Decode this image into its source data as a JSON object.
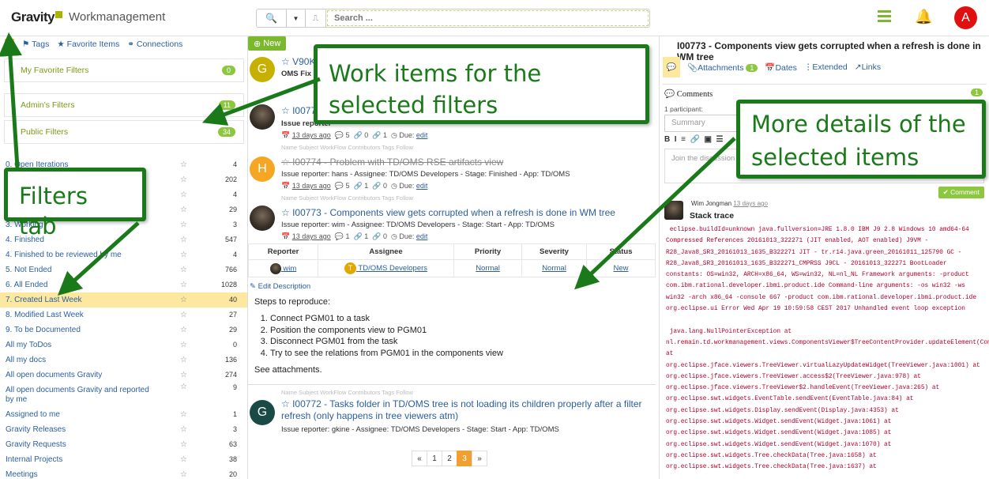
{
  "header": {
    "logo": "Gravity",
    "app_title": "Workmanagement",
    "search_placeholder": "Search ...",
    "avatar_letter": "A"
  },
  "left": {
    "tabs": [
      "Tags",
      "Favorite Items",
      "Connections"
    ],
    "fav_filters": {
      "label": "My Favorite Filters",
      "count": "0"
    },
    "admin_filters": {
      "label": "Admin's Filters",
      "count": "11"
    },
    "public_filters": {
      "label": "Public Filters",
      "count": "34"
    },
    "filters": [
      {
        "label": "0. Open Iterations",
        "count": "4"
      },
      {
        "label": "",
        "count": "202"
      },
      {
        "label": "",
        "count": "4"
      },
      {
        "label": "",
        "count": "29"
      },
      {
        "label": "3. Working",
        "count": "3"
      },
      {
        "label": "4. Finished",
        "count": "547"
      },
      {
        "label": "4. Finished to be reviewed by me",
        "count": "4"
      },
      {
        "label": "5. Not Ended",
        "count": "766"
      },
      {
        "label": "6. All Ended",
        "count": "1028"
      },
      {
        "label": "7. Created Last Week",
        "count": "40"
      },
      {
        "label": "8. Modified Last Week",
        "count": "27"
      },
      {
        "label": "9. To be Documented",
        "count": "29"
      },
      {
        "label": "All my ToDos",
        "count": "0"
      },
      {
        "label": "All my docs",
        "count": "136"
      },
      {
        "label": "All open documents Gravity",
        "count": "274"
      },
      {
        "label": "All open documents Gravity and reported by me",
        "count": "9"
      },
      {
        "label": "Assigned to me",
        "count": "1"
      },
      {
        "label": "Gravity Releases",
        "count": "3"
      },
      {
        "label": "Gravity Requests",
        "count": "63"
      },
      {
        "label": "Internal Projects",
        "count": "38"
      },
      {
        "label": "Meetings",
        "count": "20"
      }
    ]
  },
  "middle": {
    "new_label": "New",
    "items": [
      {
        "avatar": "G",
        "title": "V90K",
        "meta": "OMS Fix re"
      },
      {
        "avatar": "",
        "title": "I0077",
        "meta": "Issue reporter",
        "age": "13 days ago",
        "comments": "5",
        "links": "0",
        "subs": "1",
        "due": "Due:",
        "due_link": "edit"
      },
      {
        "avatar": "H",
        "title": "I00774 - Problem with TD/OMS RSE artifacts view",
        "meta": "Issue reporter: hans - Assignee: TD/OMS Developers - Stage: Finished - App: TD/OMS",
        "age": "13 days ago",
        "comments": "5",
        "links": "1",
        "subs": "0",
        "due": "Due:",
        "due_link": "edit"
      },
      {
        "avatar": "",
        "title": "I00773 - Components view gets corrupted when a refresh is done in WM tree",
        "meta": "Issue reporter: wim - Assignee: TD/OMS Developers - Stage: Start - App: TD/OMS",
        "age": "13 days ago",
        "comments": "1",
        "links": "1",
        "subs": "0",
        "due": "Due:",
        "due_link": "edit"
      },
      {
        "avatar": "G",
        "title": "I00772 - Tasks folder in TD/OMS tree is not loading its children properly after a filter refresh (only happens in tree viewers atm)",
        "meta": "Issue reporter: gkine - Assignee: TD/OMS Developers - Stage: Start - App: TD/OMS"
      }
    ],
    "toolbar_words": "Name  Subject  WorkFlow  Contributors  Tags  Follow",
    "table_headers": [
      "Reporter",
      "Assignee",
      "Priority",
      "Severity",
      "Status"
    ],
    "table_row": {
      "reporter": "wim",
      "assignee_badge": "T",
      "assignee": "TD/OMS Developers",
      "priority": "Normal",
      "severity": "Normal",
      "status": "New"
    },
    "edit_description": "Edit Description",
    "steps_title": "Steps to reproduce:",
    "steps": [
      "Connect PGM01 to a task",
      "Position the components view to PGM01",
      "Disconnect PGM01 from the task",
      "Try to see the relations from PGM01 in the components view"
    ],
    "see_attachments": "See attachments.",
    "pager": [
      "«",
      "1",
      "2",
      "3",
      "»"
    ]
  },
  "right": {
    "title": "I00773 - Components view gets corrupted when a refresh is done in WM tree",
    "tabs": {
      "attachments": "Attachments",
      "attachments_count": "1",
      "dates": "Dates",
      "extended": "Extended",
      "links": "Links"
    },
    "comments_label": "Comments",
    "comments_count": "1",
    "participants": "1 participant:",
    "summary_placeholder": "Summary",
    "textarea_placeholder": "Join the discussion",
    "comment_button": "Comment",
    "author": "Wim Jongman",
    "author_date": "13 days ago",
    "stack_title": "Stack trace",
    "stack_text": " eclipse.buildId=unknown java.fullversion=JRE 1.8.0 IBM J9 2.8 Windows 10 amd64-64 Compressed References 20161013_322271 (JIT enabled, AOT enabled) J9VM - R28_Java8_SR3_20161013_1635_B322271 JIT - tr.r14.java.green_20161011_125790 GC - R28_Java8_SR3_20161013_1635_B322271_CMPRSS J9CL - 20161013_322271 BootLoader constants: OS=win32, ARCH=x86_64, WS=win32, NL=nl_NL Framework arguments: -product com.ibm.rational.developer.ibmi.product.ide Command-line arguments: -os win32 -ws win32 -arch x86_64 -console 667 -product com.ibm.rational.developer.ibmi.product.ide org.eclipse.ui Error Wed Apr 19 10:59:58 CEST 2017 Unhandled event loop exception\n\n java.lang.NullPointerException at\nnl.remain.td.workmanagement.views.ComponentsViewer$TreeContentProvider.updateElement(ComponentsViewer.java:221) at\norg.eclipse.jface.viewers.TreeViewer.virtualLazyUpdateWidget(TreeViewer.java:1001) at\norg.eclipse.jface.viewers.TreeViewer.access$2(TreeViewer.java:978) at\norg.eclipse.jface.viewers.TreeViewer$2.handleEvent(TreeViewer.java:265) at\norg.eclipse.swt.widgets.EventTable.sendEvent(EventTable.java:84) at\norg.eclipse.swt.widgets.Display.sendEvent(Display.java:4353) at\norg.eclipse.swt.widgets.Widget.sendEvent(Widget.java:1061) at\norg.eclipse.swt.widgets.Widget.sendEvent(Widget.java:1085) at\norg.eclipse.swt.widgets.Widget.sendEvent(Widget.java:1070) at\norg.eclipse.swt.widgets.Tree.checkData(Tree.java:1658) at\norg.eclipse.swt.widgets.Tree.checkData(Tree.java:1637) at"
  },
  "callouts": {
    "work_items": "Work items for the selected filters",
    "details": "More details of the selected items",
    "filters_tab": "Filters tab"
  },
  "colors": {
    "accent_green": "#7ab82e",
    "callout_green": "#1a7a1a",
    "link_blue": "#2a5fa0",
    "avatar_red": "#e01010"
  }
}
